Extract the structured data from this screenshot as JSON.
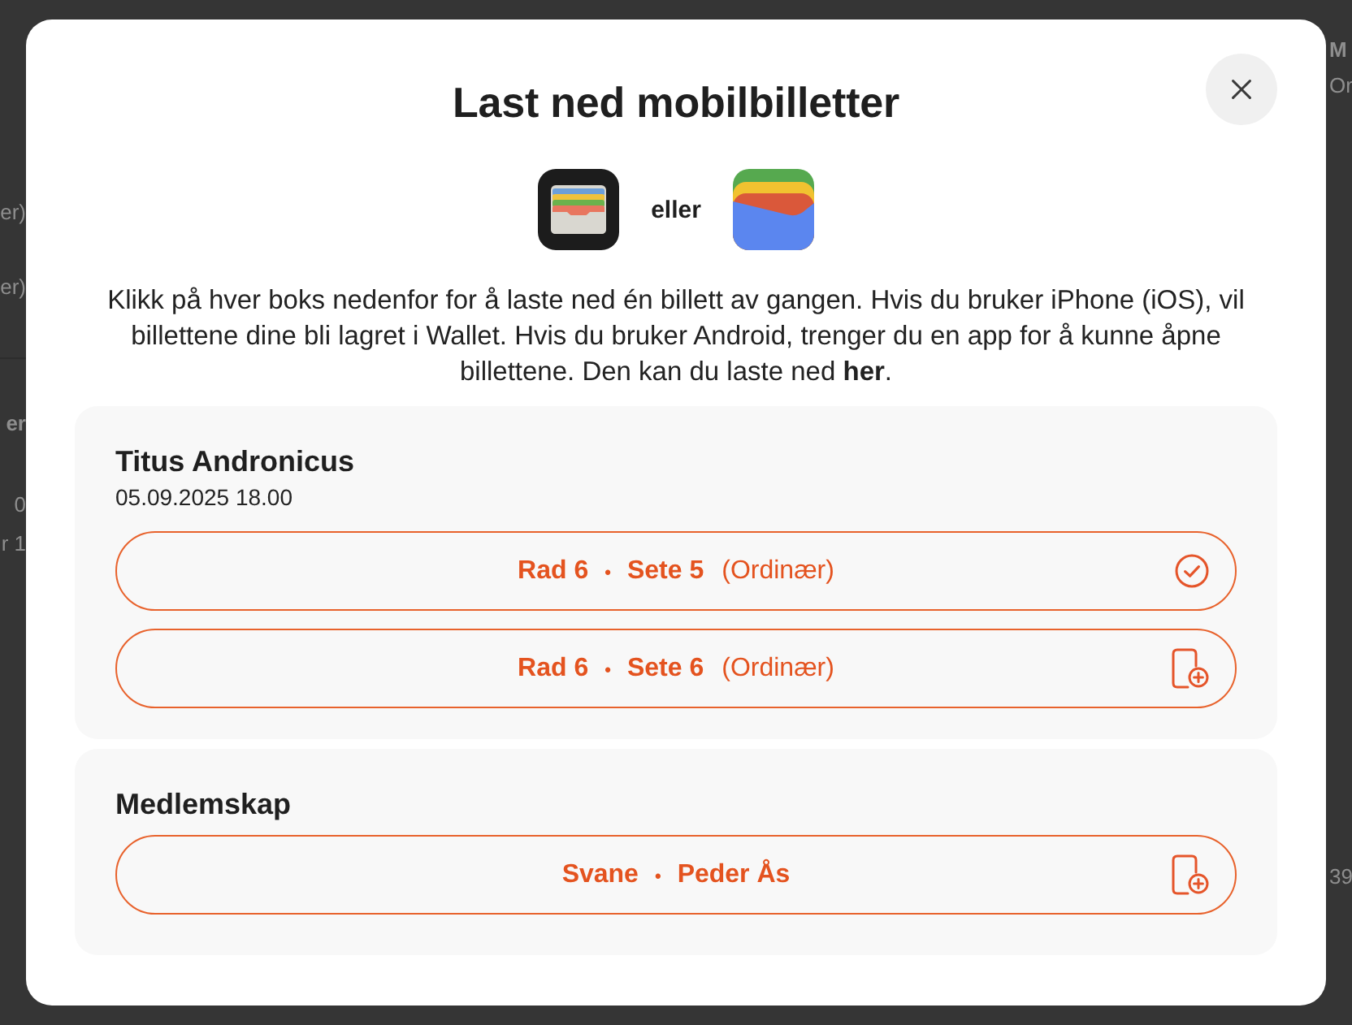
{
  "background_page": {
    "left_groups": [
      [
        {
          "text": "er)",
          "bold": false
        },
        {
          "text": "er)",
          "bold": false
        }
      ],
      [
        {
          "text": "er",
          "bold": true
        },
        {
          "text": "0",
          "bold": false
        },
        {
          "text": "r 1",
          "bold": false
        }
      ]
    ],
    "right_fragments": [
      {
        "text": "M",
        "bold": true
      },
      {
        "text": "Or",
        "bold": false
      },
      {
        "text": "39",
        "bold": false
      }
    ]
  },
  "modal": {
    "title": "Last ned mobilbilletter",
    "apps": {
      "separator": "eller"
    },
    "intro": {
      "text": "Klikk på hver boks nedenfor for å laste ned én billett av gangen. Hvis du bruker iPhone (iOS), vil billettene dine bli lagret i Wallet. Hvis du bruker Android, trenger du en app for å kunne åpne billettene. Den kan du laste ned ",
      "link": "her",
      "end": "."
    },
    "separator": "•",
    "sections": [
      {
        "title": "Titus Andronicus",
        "date": "05.09.2025 18.00",
        "items": [
          {
            "parts": [
              "Rad 6",
              "Sete 5"
            ],
            "note": "(Ordinær)",
            "downloaded": true
          },
          {
            "parts": [
              "Rad 6",
              "Sete 6"
            ],
            "note": "(Ordinær)",
            "downloaded": false
          }
        ]
      },
      {
        "title": "Medlemskap",
        "items": [
          {
            "parts": [
              "Svane",
              "Peder Ås"
            ],
            "downloaded": false
          }
        ]
      }
    ]
  }
}
